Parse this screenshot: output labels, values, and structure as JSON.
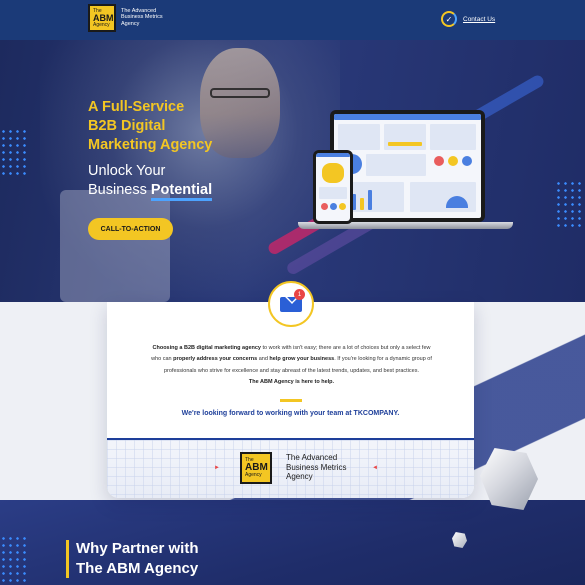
{
  "header": {
    "logo": {
      "line1": "The",
      "line2": "ABM",
      "line3": "Agency"
    },
    "brand_line1": "The Advanced",
    "brand_line2": "Business Metrics",
    "brand_line3": "Agency",
    "contact_label": "Contact Us"
  },
  "hero": {
    "headline_line1": "A Full-Service",
    "headline_line2": "B2B Digital",
    "headline_line3": "Marketing Agency",
    "sub_line1": "Unlock Your",
    "sub_line2_prefix": "Business ",
    "sub_line2_bold": "Potential",
    "cta_label": "CALL-TO-ACTION"
  },
  "card": {
    "mail_badge": "1",
    "p1_bold": "Choosing a B2B digital marketing agency",
    "p1_rest": " to work with isn't easy; there are a lot of choices but only a select few",
    "p2_a": "who can ",
    "p2_bold1": "properly address your concerns",
    "p2_b": " and ",
    "p2_bold2": "help grow your business",
    "p2_c": ". If you're looking for a dynamic group of",
    "p3": "professionals who strive for excellence and stay abreast of the latest trends, updates, and best practices.",
    "p4_bold": "The ABM Agency is here to help.",
    "cta_text": "We're looking forward to working with your team at TKCOMPANY."
  },
  "footer_logo": {
    "line1": "The",
    "line2": "ABM",
    "line3": "Agency",
    "name_line1": "The Advanced",
    "name_line2": "Business Metrics",
    "name_line3": "Agency",
    "arrow": "►"
  },
  "bottom": {
    "why_line1": "Why Partner with",
    "why_line2": "The ABM Agency"
  },
  "icons": {
    "contact": "headset-icon",
    "mail": "mail-icon"
  },
  "colors": {
    "brand_yellow": "#f3c623",
    "brand_navy": "#1b3a78",
    "accent_blue": "#1e3f9a",
    "alert_red": "#e94545"
  }
}
